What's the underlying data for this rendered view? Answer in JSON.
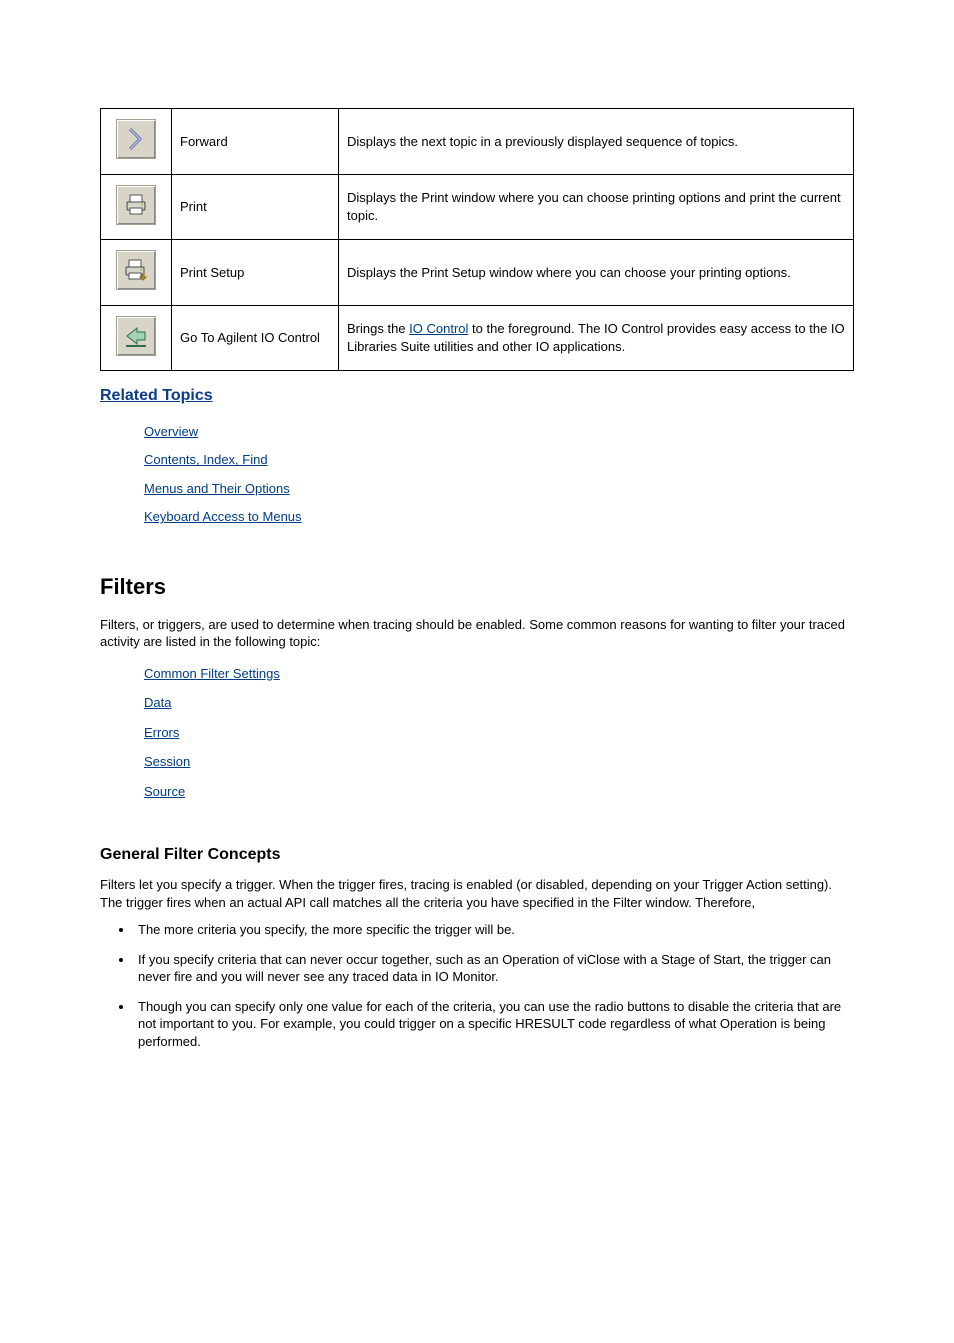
{
  "table": {
    "rows": [
      {
        "icon": "forward-icon",
        "label": "Forward",
        "desc": "Displays the next topic in a previously displayed sequence of topics."
      },
      {
        "icon": "print-icon",
        "label": "Print",
        "desc": "Displays the Print window where you can choose printing options and print the current topic."
      },
      {
        "icon": "print-setup-icon",
        "label": "Print Setup",
        "desc": "Displays the Print Setup window where you can choose your printing options."
      },
      {
        "icon": "goto-icon",
        "label": "Go To Agilent IO Control",
        "desc_prefix": "Brings the ",
        "desc_link_text": "IO Control",
        "desc_suffix": " to the foreground. The IO Control provides easy access to the IO Libraries Suite utilities and other IO applications."
      }
    ]
  },
  "related": {
    "heading": "Related Topics",
    "items": [
      "Overview",
      "Contents, Index, Find",
      "Menus and Their Options",
      "Keyboard Access to Menus"
    ]
  },
  "filters": {
    "heading": "Filters",
    "p1": "Filters, or triggers, are used to determine when tracing should be enabled. Some common reasons for wanting to filter your traced activity are listed in the following topic:",
    "common_heading": "Common Filter Settings",
    "common_items": [
      "Data",
      "Errors",
      "Session",
      "Source"
    ]
  },
  "general": {
    "heading": "General Filter Concepts",
    "p1": "Filters let you specify a trigger. When the trigger fires, tracing is enabled (or disabled, depending on your Trigger Action setting). The trigger fires when an actual API call matches all the criteria you have specified in the Filter window. Therefore,",
    "bullets": [
      "The more criteria you specify, the more specific the trigger will be.",
      "If you specify criteria that can never occur together, such as an Operation of viClose with a Stage of Start, the trigger can never fire and you will never see any traced data in IO Monitor.",
      "Though you can specify only one value for each of the criteria, you can use the radio buttons to disable the criteria that are not important to you. For example, you could trigger on a specific HRESULT code regardless of what Operation is being performed."
    ]
  }
}
